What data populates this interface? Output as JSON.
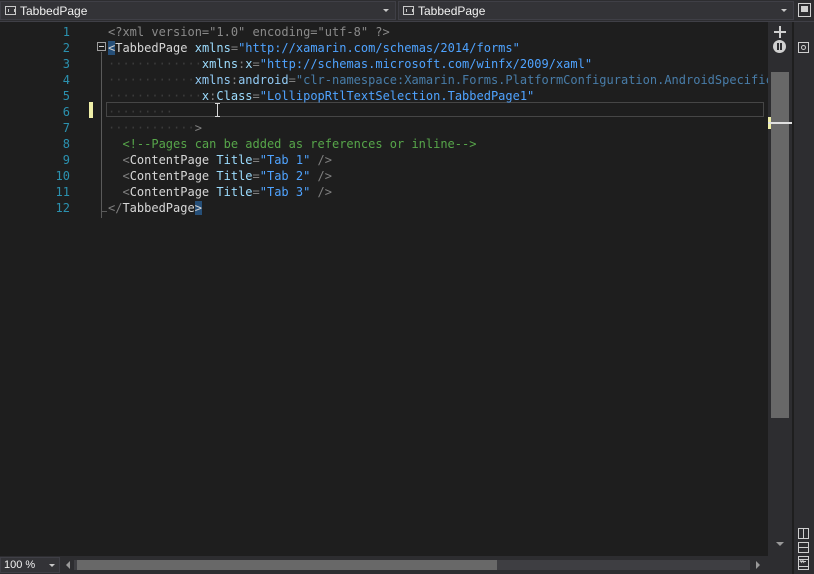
{
  "navbar": {
    "left_dropdown": {
      "label": "TabbedPage",
      "icon": "xaml-element-icon"
    },
    "right_dropdown": {
      "label": "TabbedPage",
      "icon": "xaml-element-icon"
    }
  },
  "editor": {
    "line_numbers": [
      "1",
      "2",
      "3",
      "4",
      "5",
      "6",
      "7",
      "8",
      "9",
      "10",
      "11",
      "12"
    ],
    "current_line": 6,
    "lines": [
      [
        {
          "c": "t-decl",
          "t": "<?xml version=\"1.0\" encoding=\"utf-8\" ?>"
        }
      ],
      [
        {
          "c": "t-hl",
          "t": "<"
        },
        {
          "c": "t-elem",
          "t": "TabbedPage "
        },
        {
          "c": "t-attr",
          "t": "xmlns"
        },
        {
          "c": "t-bracket",
          "t": "="
        },
        {
          "c": "t-val",
          "t": "\"http://xamarin.com/schemas/2014/forms\""
        }
      ],
      [
        {
          "c": "ws",
          "t": "·············"
        },
        {
          "c": "t-attr",
          "t": "xmlns"
        },
        {
          "c": "t-bracket",
          "t": ":"
        },
        {
          "c": "t-attr",
          "t": "x"
        },
        {
          "c": "t-bracket",
          "t": "="
        },
        {
          "c": "t-val",
          "t": "\"http://schemas.microsoft.com/winfx/2009/xaml\""
        }
      ],
      [
        {
          "c": "ws",
          "t": "············"
        },
        {
          "c": "t-attr2",
          "t": "xmlns"
        },
        {
          "c": "t-bracket",
          "t": ":"
        },
        {
          "c": "t-attr2",
          "t": "android"
        },
        {
          "c": "t-bracket",
          "t": "="
        },
        {
          "c": "t-val-dim",
          "t": "\"clr-namespace:Xamarin.Forms.PlatformConfiguration.AndroidSpecific;a"
        }
      ],
      [
        {
          "c": "ws",
          "t": "·············"
        },
        {
          "c": "t-attr",
          "t": "x"
        },
        {
          "c": "t-bracket",
          "t": ":"
        },
        {
          "c": "t-attr",
          "t": "Class"
        },
        {
          "c": "t-bracket",
          "t": "="
        },
        {
          "c": "t-val",
          "t": "\"LollipopRtlTextSelection.TabbedPage1\""
        }
      ],
      [
        {
          "c": "ws",
          "t": "·········"
        }
      ],
      [
        {
          "c": "ws",
          "t": "············"
        },
        {
          "c": "t-bracket",
          "t": ">"
        }
      ],
      [
        {
          "c": "ws",
          "t": "  "
        },
        {
          "c": "t-comment",
          "t": "<!--Pages can be added as references or inline-->"
        }
      ],
      [
        {
          "c": "ws",
          "t": "  "
        },
        {
          "c": "t-bracket",
          "t": "<"
        },
        {
          "c": "t-elem",
          "t": "ContentPage "
        },
        {
          "c": "t-attr",
          "t": "Title"
        },
        {
          "c": "t-bracket",
          "t": "="
        },
        {
          "c": "t-val",
          "t": "\"Tab 1\""
        },
        {
          "c": "t-bracket",
          "t": " />"
        }
      ],
      [
        {
          "c": "ws",
          "t": "  "
        },
        {
          "c": "t-bracket",
          "t": "<"
        },
        {
          "c": "t-elem",
          "t": "ContentPage "
        },
        {
          "c": "t-attr",
          "t": "Title"
        },
        {
          "c": "t-bracket",
          "t": "="
        },
        {
          "c": "t-val",
          "t": "\"Tab 2\""
        },
        {
          "c": "t-bracket",
          "t": " />"
        }
      ],
      [
        {
          "c": "ws",
          "t": "  "
        },
        {
          "c": "t-bracket",
          "t": "<"
        },
        {
          "c": "t-elem",
          "t": "ContentPage "
        },
        {
          "c": "t-attr",
          "t": "Title"
        },
        {
          "c": "t-bracket",
          "t": "="
        },
        {
          "c": "t-val",
          "t": "\"Tab 3\""
        },
        {
          "c": "t-bracket",
          "t": " />"
        }
      ],
      [
        {
          "c": "t-bracket",
          "t": "</"
        },
        {
          "c": "t-elem",
          "t": "TabbedPage"
        },
        {
          "c": "t-hl",
          "t": ">"
        }
      ]
    ]
  },
  "statusbar": {
    "zoom": "100 %"
  },
  "colors": {
    "background": "#1e1e1e",
    "line_number": "#2b91af",
    "string_value": "#4fa3ff",
    "comment": "#57a64a",
    "change_marker": "#efefa8"
  },
  "icons": {
    "split": "split-editor-icon",
    "pause": "pause-icon",
    "collapse": "collapse-icon"
  }
}
